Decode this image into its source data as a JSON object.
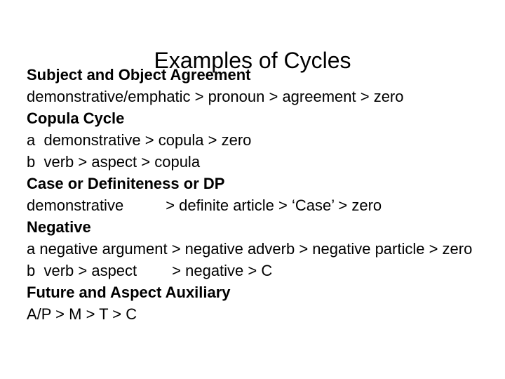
{
  "slide": {
    "title": "Examples of Cycles",
    "background_color": "#ffffff",
    "text_color": "#000000",
    "lines": [
      {
        "id": "subject-object-agreement-heading",
        "style": "heading",
        "text": "Subject and Object Agreement"
      },
      {
        "id": "subject-object-agreement-chain",
        "style": "body",
        "text": "demonstrative/emphatic > pronoun > agreement > zero"
      },
      {
        "id": "copula-cycle-heading",
        "style": "heading",
        "text": "Copula Cycle"
      },
      {
        "id": "copula-cycle-a",
        "style": "body",
        "text": "a  demonstrative > copula > zero"
      },
      {
        "id": "copula-cycle-b",
        "style": "body",
        "text": "b  verb > aspect > copula"
      },
      {
        "id": "case-definiteness-dp-heading",
        "style": "heading",
        "text": "Case or Definiteness or DP"
      },
      {
        "id": "case-definiteness-dp-chain",
        "style": "body-tabbed",
        "text_before_gap": "demonstrative",
        "text_after_gap": "> definite article > ‘Case’ > zero"
      },
      {
        "id": "negative-heading",
        "style": "heading",
        "text": "Negative"
      },
      {
        "id": "negative-a",
        "style": "body-wrap",
        "text": "a  negative argument > negative adverb > negative particle > zero"
      },
      {
        "id": "negative-b",
        "style": "body-tabbed-narrow",
        "text_before_gap": "b  verb > aspect",
        "text_after_gap": "> negative > C"
      },
      {
        "id": "future-aspect-auxiliary-heading",
        "style": "heading",
        "text": "Future and Aspect Auxiliary"
      },
      {
        "id": "future-aspect-auxiliary-chain",
        "style": "body",
        "text": "A/P > M > T > C"
      }
    ]
  }
}
